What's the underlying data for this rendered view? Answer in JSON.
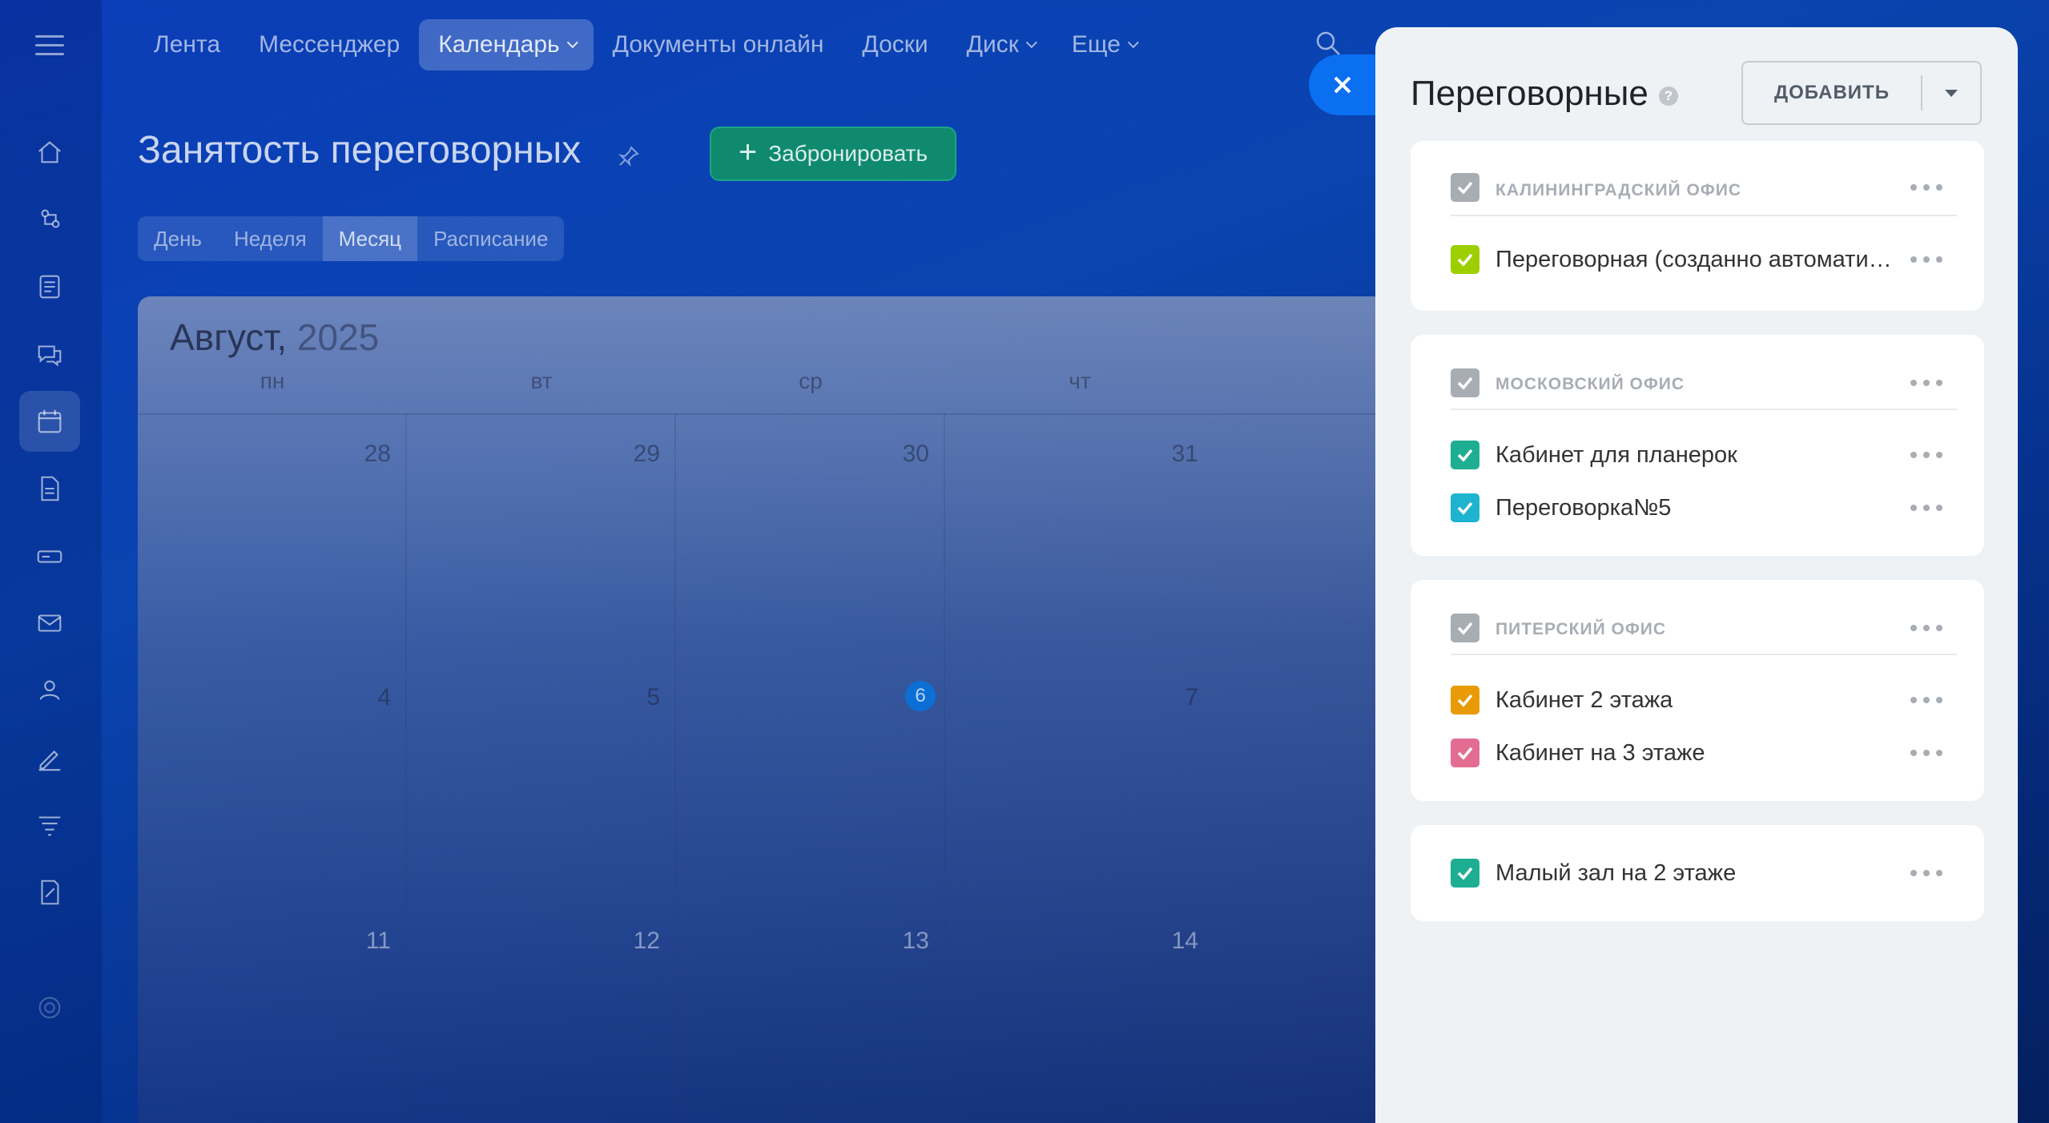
{
  "nav": {
    "items": [
      {
        "label": "Лента",
        "active": false,
        "dropdown": false
      },
      {
        "label": "Мессенджер",
        "active": false,
        "dropdown": false
      },
      {
        "label": "Календарь",
        "active": true,
        "dropdown": true
      },
      {
        "label": "Документы онлайн",
        "active": false,
        "dropdown": false
      },
      {
        "label": "Доски",
        "active": false,
        "dropdown": false
      },
      {
        "label": "Диск",
        "active": false,
        "dropdown": true
      },
      {
        "label": "Еще",
        "active": false,
        "dropdown": true
      }
    ]
  },
  "page": {
    "title": "Занятость переговорных",
    "book_button": "Забронировать",
    "view_tabs": [
      "День",
      "Неделя",
      "Месяц",
      "Расписание"
    ],
    "active_view": "Месяц"
  },
  "calendar": {
    "month": "Август,",
    "year": "2025",
    "weekdays": [
      "пн",
      "вт",
      "ср",
      "чт"
    ],
    "weeks": [
      [
        "28",
        "29",
        "30",
        "31"
      ],
      [
        "4",
        "5",
        "6",
        "7"
      ],
      [
        "11",
        "12",
        "13",
        "14"
      ]
    ],
    "today": "6"
  },
  "panel": {
    "title": "Переговорные",
    "add_button": "ДОБАВИТЬ",
    "groups": [
      {
        "name": "КАЛИНИНГРАДСКИЙ ОФИС",
        "rooms": [
          {
            "name": "Переговорная (созданно автоматически)",
            "color": "#9dcf00"
          }
        ]
      },
      {
        "name": "МОСКОВСКИЙ ОФИС",
        "rooms": [
          {
            "name": "Кабинет для планерок",
            "color": "#1eae91"
          },
          {
            "name": "Переговорка№5",
            "color": "#1eb4d0"
          }
        ]
      },
      {
        "name": "ПИТЕРСКИЙ ОФИС",
        "rooms": [
          {
            "name": "Кабинет 2 этажа",
            "color": "#e89b06"
          },
          {
            "name": "Кабинет на 3 этаже",
            "color": "#e36d92"
          }
        ]
      }
    ],
    "ungrouped": [
      {
        "name": "Малый зал на 2 этаже",
        "color": "#1eae91"
      }
    ]
  },
  "colors": {
    "group_checkbox": "#a8adb4",
    "close_button": "#0b6ff2",
    "book_button": "#0f8a6f",
    "today_badge": "#0c6fd6"
  }
}
